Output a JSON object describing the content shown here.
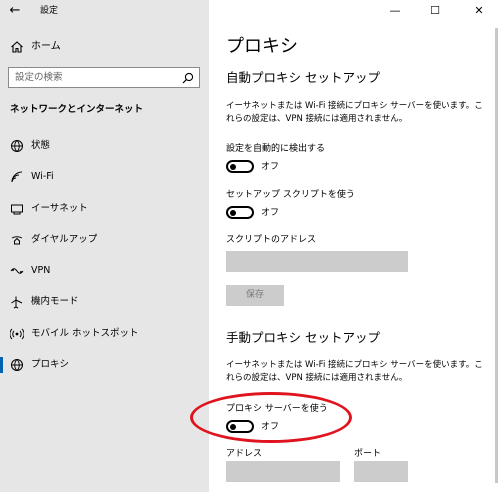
{
  "app": {
    "title": "設定",
    "back_glyph": "←"
  },
  "window_controls": {
    "minimize": "—",
    "maximize": "☐",
    "close": "✕"
  },
  "sidebar": {
    "home_label": "ホーム",
    "search_placeholder": "設定の検索",
    "section_title": "ネットワークとインターネット",
    "items": [
      {
        "label": "状態",
        "icon": "globe-status-icon"
      },
      {
        "label": "Wi-Fi",
        "icon": "wifi-icon"
      },
      {
        "label": "イーサネット",
        "icon": "ethernet-icon"
      },
      {
        "label": "ダイヤルアップ",
        "icon": "dialup-icon"
      },
      {
        "label": "VPN",
        "icon": "vpn-icon"
      },
      {
        "label": "機内モード",
        "icon": "airplane-icon"
      },
      {
        "label": "モバイル ホットスポット",
        "icon": "hotspot-icon"
      },
      {
        "label": "プロキシ",
        "icon": "globe-icon",
        "selected": true
      }
    ]
  },
  "main": {
    "page_title": "プロキシ",
    "auto_section": {
      "title": "自動プロキシ セットアップ",
      "description": "イーサネットまたは Wi-Fi 接続にプロキシ サーバーを使います。これらの設定は、VPN 接続には適用されません。",
      "auto_detect_label": "設定を自動的に検出する",
      "auto_detect_state": "オフ",
      "use_script_label": "セットアップ スクリプトを使う",
      "use_script_state": "オフ",
      "script_address_label": "スクリプトのアドレス",
      "script_address_value": "",
      "save_label": "保存"
    },
    "manual_section": {
      "title": "手動プロキシ セットアップ",
      "description": "イーサネットまたは Wi-Fi 接続にプロキシ サーバーを使います。これらの設定は、VPN 接続には適用されません。",
      "use_proxy_label": "プロキシ サーバーを使う",
      "use_proxy_state": "オフ",
      "address_label": "アドレス",
      "address_value": "",
      "port_label": "ポート",
      "port_value": ""
    }
  },
  "colors": {
    "accent": "#0063b1",
    "highlight_circle": "#e0141e",
    "sidebar_bg": "#e6e6e6"
  }
}
